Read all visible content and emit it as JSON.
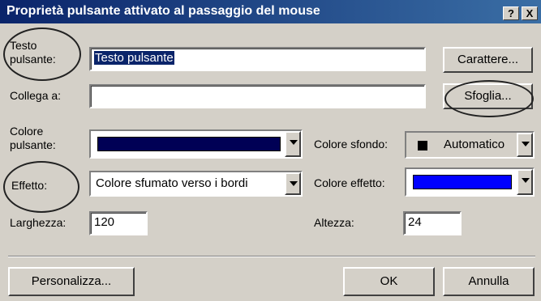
{
  "title": "Proprietà pulsante attivato al passaggio del mouse",
  "title_buttons": {
    "help": "?",
    "close": "X"
  },
  "fields": {
    "button_text": {
      "label_line1": "Testo",
      "label_line2": "pulsante:",
      "value": "Testo pulsante"
    },
    "link": {
      "label": "Collega a:",
      "value": ""
    },
    "button_color": {
      "label_line1": "Colore",
      "label_line2": "pulsante:",
      "swatch": "#000055"
    },
    "bg_color": {
      "label": "Colore sfondo:",
      "value": "Automatico",
      "swatch": "#000000"
    },
    "effect": {
      "label": "Effetto:",
      "value": "Colore sfumato verso i bordi"
    },
    "effect_color": {
      "label": "Colore effetto:",
      "swatch": "#0000ff"
    },
    "width": {
      "label": "Larghezza:",
      "value": "120"
    },
    "height": {
      "label": "Altezza:",
      "value": "24"
    }
  },
  "buttons": {
    "font": "Carattere...",
    "browse": "Sfoglia...",
    "customize": "Personalizza...",
    "ok": "OK",
    "cancel": "Annulla"
  }
}
